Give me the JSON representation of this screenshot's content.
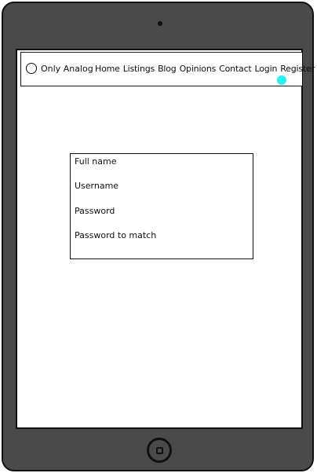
{
  "nav": {
    "brand": "Only Analog",
    "links": [
      "Home",
      "Listings",
      "Blog",
      "Opinions",
      "Contact",
      "Login",
      "Register"
    ]
  },
  "form": {
    "fields": [
      "Full name",
      "Username",
      "Password",
      "Password to match"
    ]
  },
  "colors": {
    "device_frame": "#4a4a4a",
    "screen_bg": "#ffffff",
    "cursor_highlight": "#27f0f0"
  },
  "icons": {
    "logo": "circle-logo-icon",
    "home_button": "home-button-icon",
    "camera": "camera-icon"
  }
}
